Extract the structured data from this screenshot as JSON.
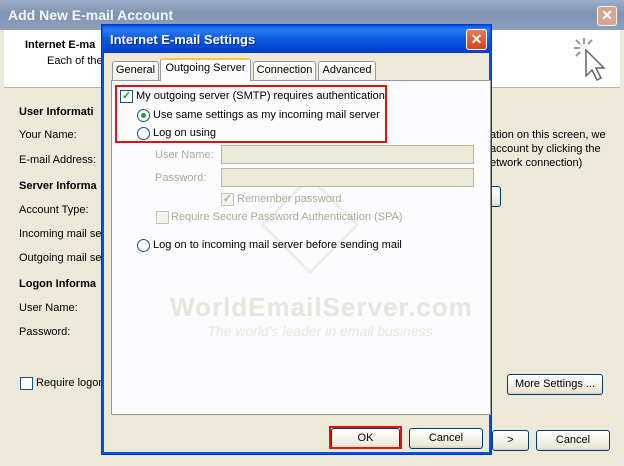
{
  "background_window": {
    "title": "Add New E-mail Account",
    "close_glyph": "✕",
    "header_title": "Internet E-ma",
    "header_subtitle": "Each of the",
    "sections": {
      "user_info": "User Informati",
      "server_info": "Server Informa",
      "logon_info": "Logon Informa"
    },
    "labels": {
      "your_name": "Your Name:",
      "email_address": "E-mail Address:",
      "account_type": "Account Type:",
      "incoming_server": "Incoming mail ser",
      "outgoing_server": "Outgoing mail ser",
      "user_name": "User Name:",
      "password": "Password:",
      "require_logon": "Require logon"
    },
    "help_text": [
      "ation on this screen, we",
      "account by clicking the",
      "etwork connection)"
    ],
    "more_settings_label": "More Settings ...",
    "next_label": ">",
    "cancel_label": "Cancel"
  },
  "dialog": {
    "title": "Internet E-mail Settings",
    "close_glyph": "✕",
    "tabs": [
      {
        "label": "General",
        "active": false
      },
      {
        "label": "Outgoing Server",
        "active": true
      },
      {
        "label": "Connection",
        "active": false
      },
      {
        "label": "Advanced",
        "active": false
      }
    ],
    "smtp_auth_label": "My outgoing server (SMTP) requires authentication",
    "smtp_auth_checked": true,
    "use_same_settings_label": "Use same settings as my incoming mail server",
    "log_on_using_label": "Log on using",
    "user_name_label": "User Name:",
    "user_name_value": "",
    "password_label": "Password:",
    "password_value": "",
    "remember_password_label": "Remember password",
    "remember_password_checked": true,
    "spa_label": "Require Secure Password Authentication (SPA)",
    "spa_checked": false,
    "log_on_incoming_label": "Log on to incoming mail server before sending mail",
    "ok_label": "OK",
    "cancel_label": "Cancel",
    "check_glyph": "✓"
  },
  "watermark": {
    "line1": "WorldEmailServer.com",
    "line2": "The world's leader in email business"
  },
  "colors": {
    "highlight": "#e51010",
    "xp_blue": "#0054e3",
    "check_green": "#21a121"
  }
}
